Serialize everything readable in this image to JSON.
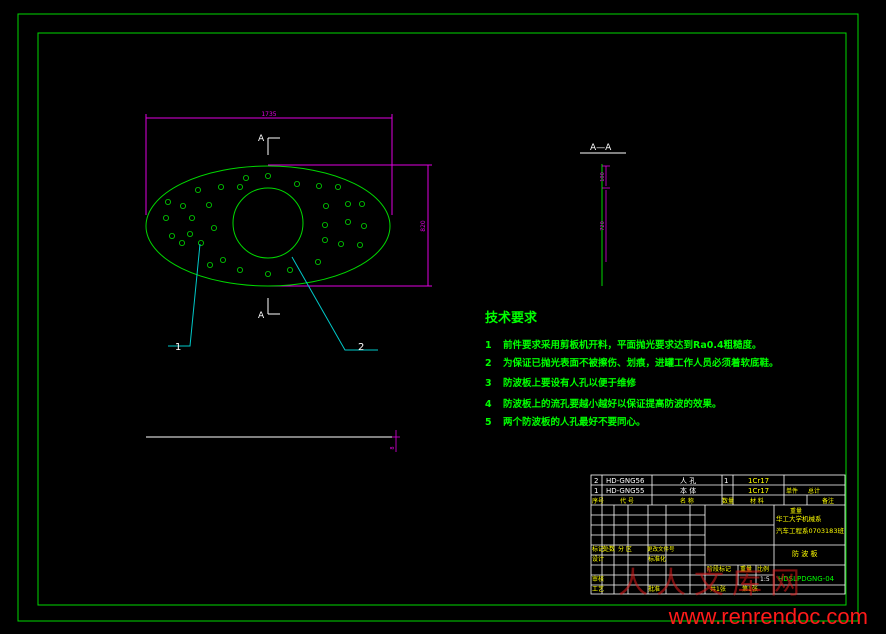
{
  "section_title": "A—A",
  "section_marks": [
    "A",
    "A"
  ],
  "dimensions": {
    "plate_width": "1735",
    "plate_height": "820",
    "thickness": "8",
    "side_top": "100",
    "side_main": "720"
  },
  "balloons": [
    "1",
    "2"
  ],
  "tech_requirements": {
    "title": "技术要求",
    "items": [
      {
        "num": "1",
        "text": "前件要求采用剪板机开料，平面抛光要求达到Ra0.4粗糙度。"
      },
      {
        "num": "2",
        "text": "为保证已抛光表面不被擦伤、划痕，进罐工作人员必须着软底鞋。"
      },
      {
        "num": "3",
        "text": "防波板上要设有人孔以便于维修"
      },
      {
        "num": "4",
        "text": "防波板上的流孔要越小越好以保证提高防波的效果。"
      },
      {
        "num": "5",
        "text": "两个防波板的人孔最好不要同心。"
      }
    ]
  },
  "title_block": {
    "parts": [
      {
        "seq": "2",
        "code": "HD-GNG56",
        "name": "人 孔",
        "qty": "1",
        "material": "1Cr17"
      },
      {
        "seq": "1",
        "code": "HD-GNG55",
        "name": "本 体",
        "qty": "",
        "material": "1Cr17"
      }
    ],
    "header": [
      "序号",
      "代 号",
      "名 称",
      "数量",
      "材 料"
    ],
    "single_total": [
      "单件",
      "总计"
    ],
    "weight_label": "重量",
    "remark_label": "备注",
    "company": [
      "华工大学机械系",
      "汽车工程系0703183班"
    ],
    "drawing_name": "防 波 板",
    "drawing_code": "HDSLPDGNG-04",
    "rev_row": [
      "标记",
      "处数",
      "分 区",
      "更改文件号"
    ],
    "sign_row": [
      "签字",
      "年月日"
    ],
    "design": "设计",
    "standard": "标准化",
    "stage_label": "阶段标记",
    "weight_label2": "重量",
    "scale_label": "比例",
    "scale_value": "1:5",
    "review": "审核",
    "process": "工艺",
    "approve": "批准",
    "sheets": "共1张",
    "sheet_no": "第1张"
  },
  "watermark": {
    "cn": "人人文库网",
    "url": "www.renrendoc.com"
  },
  "colors": {
    "frame": "#00d800",
    "dim": "#e000e0",
    "leader": "#00c8c8",
    "text": "#f0f0f0"
  }
}
